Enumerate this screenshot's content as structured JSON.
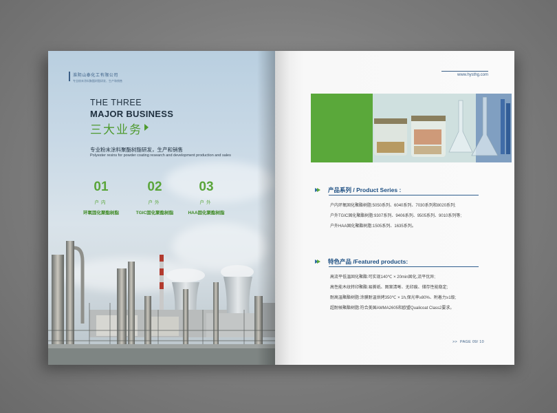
{
  "left_page": {
    "company_name": "淮阴山泰化工有限公司",
    "company_sub": "专业粉末涂料聚酯树脂研发、生产和销售",
    "title_line1": "THE THREE",
    "title_line2": "MAJOR BUSINESS",
    "title_cn": "三大业务",
    "description_cn": "专业粉末涂料聚酯树脂研发，生产和销售",
    "description_en": "Polyester resins for powder coating research and development production and sales",
    "businesses": [
      {
        "number": "01",
        "type": "户内",
        "name": "环氧固化聚酯树脂"
      },
      {
        "number": "02",
        "type": "户外",
        "name": "TGIC固化聚酯树脂"
      },
      {
        "number": "03",
        "type": "户外",
        "name": "HAA固化聚酯树脂"
      }
    ]
  },
  "right_page": {
    "url": "www.hysthg.com",
    "product_series": {
      "title": "产品系列 / Product Series :",
      "lines": [
        "户内环氧固化聚酯树脂:5050系列、6040系列、7030系列和8020系列;",
        "户外TGIC固化聚酯树脂:9307系列、9406系列、9505系列、9010系列等;",
        "户外HAA固化聚酯树脂:1505系列、1635系列。"
      ]
    },
    "featured_products": {
      "title": "特色产品 /Featured products:",
      "lines": [
        "高流平低温固化聚酯:可实现140℃ × 20min固化,流平优异;",
        "高性能木纹转印聚酯:易撕纸、图案清晰、无印痕、储存性能稳定;",
        "耐高温聚酯树脂:涂膜耐温烘烤350℃ × 1h,保光率≥80%、附着力≥1级;",
        "超耐候聚酯树脂:符合美国AMMA2605和欧盟Qualicoat Class2要求。"
      ]
    },
    "footer": {
      "arrows": ">>",
      "page_label": "PAGE",
      "page_number": "09/ 10"
    }
  },
  "colors": {
    "accent_green": "#5aa83a",
    "accent_blue": "#1d4f82",
    "background_gray": "#8a8a8a"
  }
}
